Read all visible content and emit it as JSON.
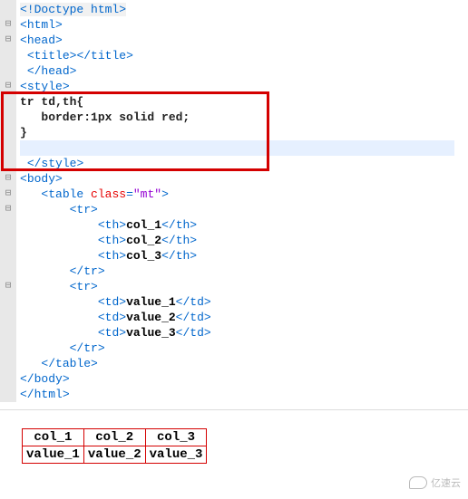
{
  "gutter": {
    "symbols": [
      "",
      "⊟",
      "⊟",
      "",
      "",
      "⊟",
      "",
      "",
      "",
      "",
      "",
      "⊟",
      "⊟",
      "⊟",
      "",
      "",
      "",
      "",
      "⊟",
      "",
      "",
      "",
      "",
      "",
      "",
      "",
      ""
    ]
  },
  "code": {
    "l1": {
      "open": "<!",
      "name": "Doctype html",
      "close": ">"
    },
    "l2": {
      "open": "<",
      "name": "html",
      "close": ">"
    },
    "l3": {
      "open": "<",
      "name": "head",
      "close": ">"
    },
    "l4": {
      "open": "<",
      "name1": "title",
      "close1": "></",
      "name2": "title",
      "close2": ">"
    },
    "l5": {
      "open": "</",
      "name": "head",
      "close": ">"
    },
    "l6": {
      "open": "<",
      "name": "style",
      "close": ">"
    },
    "l7": {
      "sel": "tr td,th{"
    },
    "l8": {
      "rule": "border:1px solid red;"
    },
    "l9": {
      "brace": "}"
    },
    "l10": {
      "text": ""
    },
    "l11": {
      "open": "</",
      "name": "style",
      "close": ">"
    },
    "l12": {
      "open": "<",
      "name": "body",
      "close": ">"
    },
    "l13": {
      "open": "<",
      "name": "table",
      "attr": "class",
      "eq": "=",
      "val": "\"mt\"",
      "close": ">"
    },
    "l14": {
      "open": "<",
      "name": "tr",
      "close": ">"
    },
    "l15": {
      "open": "<",
      "name": "th",
      "close": ">",
      "text": "col_1",
      "open2": "</",
      "name2": "th",
      "close2": ">"
    },
    "l16": {
      "open": "<",
      "name": "th",
      "close": ">",
      "text": "col_2",
      "open2": "</",
      "name2": "th",
      "close2": ">"
    },
    "l17": {
      "open": "<",
      "name": "th",
      "close": ">",
      "text": "col_3",
      "open2": "</",
      "name2": "th",
      "close2": ">"
    },
    "l18": {
      "open": "</",
      "name": "tr",
      "close": ">"
    },
    "l19": {
      "open": "<",
      "name": "tr",
      "close": ">"
    },
    "l20": {
      "open": "<",
      "name": "td",
      "close": ">",
      "text": "value_1",
      "open2": "</",
      "name2": "td",
      "close2": ">"
    },
    "l21": {
      "open": "<",
      "name": "td",
      "close": ">",
      "text": "value_2",
      "open2": "</",
      "name2": "td",
      "close2": ">"
    },
    "l22": {
      "open": "<",
      "name": "td",
      "close": ">",
      "text": "value_3",
      "open2": "</",
      "name2": "td",
      "close2": ">"
    },
    "l23": {
      "open": "</",
      "name": "tr",
      "close": ">"
    },
    "l24": {
      "open": "</",
      "name": "table",
      "close": ">"
    },
    "l25": {
      "open": "</",
      "name": "body",
      "close": ">"
    },
    "l26": {
      "open": "</",
      "name": "html",
      "close": ">"
    }
  },
  "preview": {
    "headers": [
      "col_1",
      "col_2",
      "col_3"
    ],
    "row": [
      "value_1",
      "value_2",
      "value_3"
    ]
  },
  "watermark": "亿速云"
}
